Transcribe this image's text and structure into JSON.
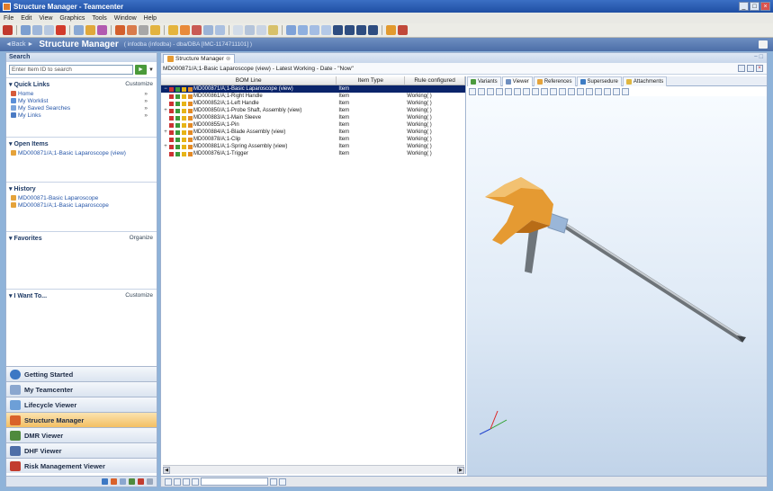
{
  "window": {
    "title": "Structure Manager - Teamcenter",
    "controls": [
      "_",
      "□",
      "×"
    ]
  },
  "menu": [
    "File",
    "Edit",
    "View",
    "Graphics",
    "Tools",
    "Window",
    "Help"
  ],
  "app_header": {
    "back": "◄Back ►",
    "title": "Structure Manager",
    "context": "( infodba (infodba) - dba/DBA  [IMC-1174711101] )"
  },
  "left": {
    "search": {
      "header": "Search",
      "placeholder": "Enter Item ID to search"
    },
    "quick_links": {
      "title": "Quick Links",
      "action": "Customize",
      "items": [
        {
          "label": "Home",
          "chev": "»"
        },
        {
          "label": "My Worklist",
          "chev": "»"
        },
        {
          "label": "My Saved Searches",
          "chev": "»"
        },
        {
          "label": "My Links",
          "chev": "»"
        }
      ]
    },
    "open_items": {
      "title": "Open Items",
      "items": [
        "MD000871/A;1-Basic Laparoscope (view)"
      ]
    },
    "history": {
      "title": "History",
      "items": [
        "MD000871-Basic Laparoscope",
        "MD000871/A;1-Basic Laparoscope"
      ]
    },
    "favorites": {
      "title": "Favorites",
      "action": "Organize"
    },
    "i_want_to": {
      "title": "I Want To...",
      "action": "Customize"
    },
    "nav": [
      {
        "label": "Getting Started"
      },
      {
        "label": "My Teamcenter"
      },
      {
        "label": "Lifecycle Viewer"
      },
      {
        "label": "Structure Manager"
      },
      {
        "label": "DMR Viewer"
      },
      {
        "label": "DHF Viewer"
      },
      {
        "label": "Risk Management Viewer"
      }
    ]
  },
  "main": {
    "tab": {
      "label": "Structure Manager",
      "close": "⊗"
    },
    "tab_controls": "− □",
    "bom_bar": "MD000871/A;1-Basic Laparoscope (view) - Latest Working - Date - \"Now\"",
    "bom": {
      "columns": [
        "BOM Line",
        "Item Type",
        "Rule configured"
      ],
      "rows": [
        {
          "exp": "−",
          "line": "MD000871/A;1-Basic Laparoscope (view)",
          "type": "Item",
          "rule": "",
          "selected": true
        },
        {
          "exp": "",
          "line": "MD000861/A;1-Right Handle",
          "type": "Item",
          "rule": "Working( )"
        },
        {
          "exp": "",
          "line": "MD000852/A;1-Left Handle",
          "type": "Item",
          "rule": "Working( )"
        },
        {
          "exp": "+",
          "line": "MD000850/A;1-Probe Shaft, Assembly (view)",
          "type": "Item",
          "rule": "Working( )"
        },
        {
          "exp": "",
          "line": "MD000883/A;1-Main Sleeve",
          "type": "Item",
          "rule": "Working( )"
        },
        {
          "exp": "",
          "line": "MD000855/A;1-Pin",
          "type": "Item",
          "rule": "Working( )"
        },
        {
          "exp": "+",
          "line": "MD000884/A;1-Blade Assembly (view)",
          "type": "Item",
          "rule": "Working( )"
        },
        {
          "exp": "",
          "line": "MD000878/A;1-Clip",
          "type": "Item",
          "rule": "Working( )"
        },
        {
          "exp": "+",
          "line": "MD000881/A;1-Spring Assembly (view)",
          "type": "Item",
          "rule": "Working( )"
        },
        {
          "exp": "",
          "line": "MD000876/A;1-Trigger",
          "type": "Item",
          "rule": "Working( )"
        }
      ]
    },
    "viewer_tabs": [
      "Variants",
      "Viewer",
      "References",
      "Supersedure",
      "Attachments"
    ]
  },
  "colors": {
    "handle": "#e59a32",
    "shaft": "#8f9499",
    "selection": "#0a246a",
    "active_nav": "#f3bf63"
  }
}
